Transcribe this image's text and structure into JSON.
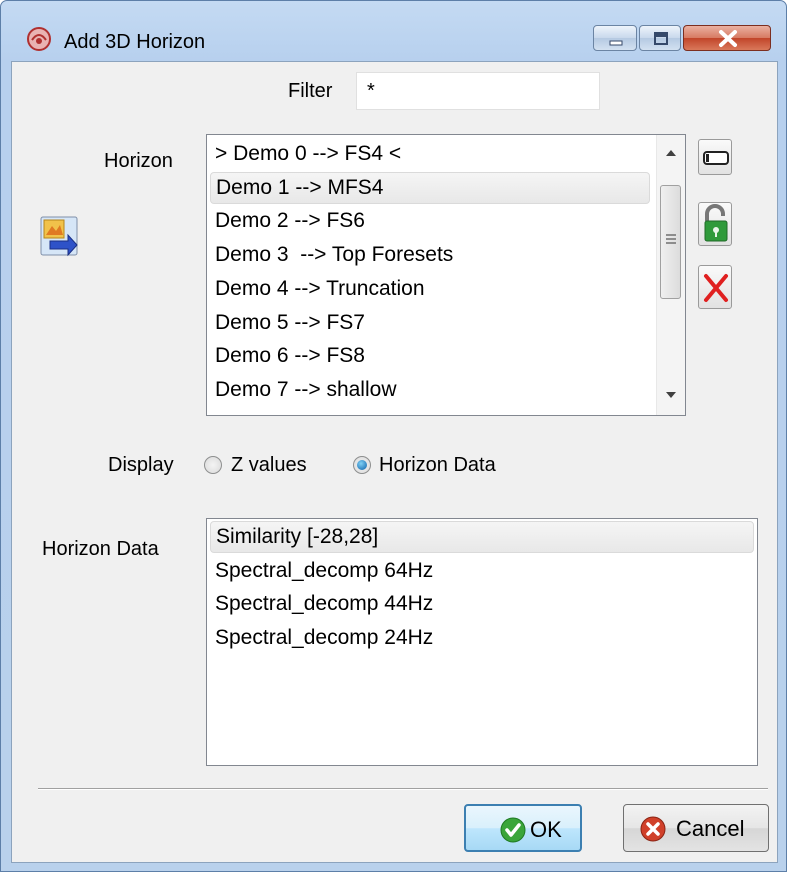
{
  "window": {
    "title": "Add 3D Horizon",
    "icon": "app-logo-icon",
    "controls": [
      "minimize-icon",
      "maximize-icon",
      "close-icon"
    ]
  },
  "filter": {
    "label": "Filter",
    "value": "*"
  },
  "horizon": {
    "label": "Horizon",
    "items": [
      "> Demo 0 --> FS4 <",
      "Demo 1 --> MFS4",
      "Demo 2 --> FS6",
      "Demo 3  --> Top Foresets",
      "Demo 4 --> Truncation",
      "Demo 5 --> FS7",
      "Demo 6 --> FS8",
      "Demo 7 --> shallow"
    ],
    "selected_index": 1,
    "side_buttons": [
      "rename-icon",
      "unlock-icon",
      "delete-icon"
    ],
    "import_button_icon": "import-horizon-icon"
  },
  "display": {
    "label": "Display",
    "options": [
      "Z values",
      "Horizon Data"
    ],
    "selected": "Horizon Data"
  },
  "horizon_data": {
    "label": "Horizon Data",
    "items": [
      "Similarity [-28,28]",
      "Spectral_decomp 64Hz",
      "Spectral_decomp 44Hz",
      "Spectral_decomp 24Hz"
    ],
    "selected_index": 0
  },
  "buttons": {
    "ok": "OK",
    "cancel": "Cancel"
  },
  "colors": {
    "ok_accent": "#3c7fb1",
    "ok_icon": "#3aa53a",
    "cancel_icon": "#d0402a",
    "close_button": "#c2452a"
  }
}
